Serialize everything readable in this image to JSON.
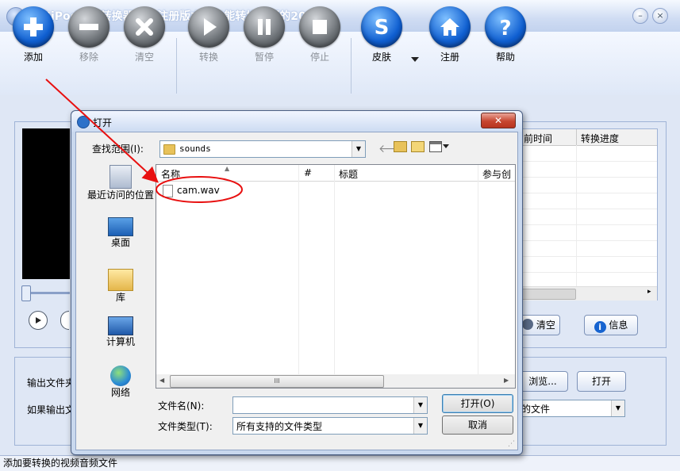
{
  "app": {
    "title": "闪电iPod视频转换器 - 未注册版本，只能转换视频的20%",
    "statusbar": "添加要转换的视频音频文件"
  },
  "toolbar": [
    {
      "label": "添加",
      "icon": "plus-icon",
      "enabled": true
    },
    {
      "label": "移除",
      "icon": "minus-icon",
      "enabled": false
    },
    {
      "label": "清空",
      "icon": "x-icon",
      "enabled": false
    },
    {
      "label": "转换",
      "icon": "play-icon",
      "enabled": false
    },
    {
      "label": "暂停",
      "icon": "pause-icon",
      "enabled": false
    },
    {
      "label": "停止",
      "icon": "stop-icon",
      "enabled": false
    },
    {
      "label": "皮肤",
      "icon": "skin-s-icon",
      "enabled": true
    },
    {
      "label": "注册",
      "icon": "home-icon",
      "enabled": true
    },
    {
      "label": "帮助",
      "icon": "help-icon",
      "enabled": true
    }
  ],
  "list": {
    "columns": [
      "前时间",
      "转换进度"
    ]
  },
  "list_buttons": {
    "clear": "清空",
    "info": "信息"
  },
  "output": {
    "dir_label": "输出文件夹",
    "exists_label": "如果输出文",
    "browse": "浏览...",
    "open": "打开",
    "exists_value": "的文件"
  },
  "dialog": {
    "title": "打开",
    "lookin_label": "查找范围(I):",
    "lookin_value": "sounds",
    "places": [
      {
        "label": "最近访问的位置",
        "icon": "recent-places-icon"
      },
      {
        "label": "桌面",
        "icon": "desktop-icon"
      },
      {
        "label": "库",
        "icon": "libraries-icon"
      },
      {
        "label": "计算机",
        "icon": "computer-icon"
      },
      {
        "label": "网络",
        "icon": "network-icon"
      }
    ],
    "columns": [
      "名称",
      "#",
      "标题",
      "参与创"
    ],
    "files": [
      {
        "name": "cam.wav"
      }
    ],
    "hscroll_grip": "III",
    "filename_label": "文件名(N):",
    "filename_value": "",
    "filetype_label": "文件类型(T):",
    "filetype_value": "所有支持的文件类型",
    "open_button": "打开(O)",
    "cancel_button": "取消"
  },
  "colors": {
    "annotation": "#e81010",
    "accent": "#0f5fd1"
  }
}
